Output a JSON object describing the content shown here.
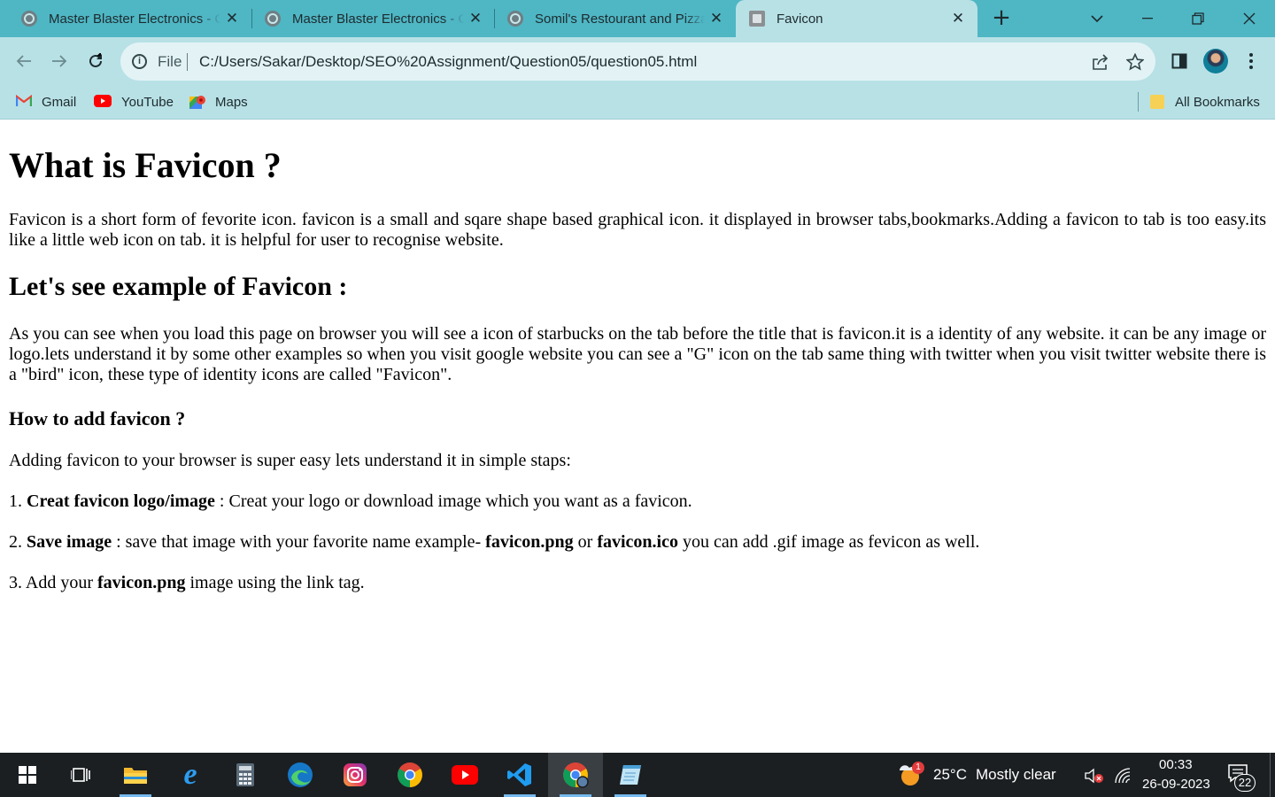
{
  "browser": {
    "tabs": [
      {
        "title": "Master Blaster Electronics - O",
        "active": false
      },
      {
        "title": "Master Blaster Electronics - O",
        "active": false
      },
      {
        "title": "Somil's Restourant and Pizza",
        "active": false
      },
      {
        "title": "Favicon",
        "active": true
      }
    ],
    "address": {
      "scheme_label": "File",
      "url": "C:/Users/Sakar/Desktop/SEO%20Assignment/Question05/question05.html"
    },
    "bookmarks": [
      {
        "label": "Gmail",
        "icon": "gmail-icon"
      },
      {
        "label": "YouTube",
        "icon": "youtube-icon"
      },
      {
        "label": "Maps",
        "icon": "maps-icon"
      }
    ],
    "all_bookmarks_label": "All Bookmarks",
    "theme_color": "#4fb6c4",
    "toolbar_color": "#b8e1e6"
  },
  "page": {
    "title": "What is Favicon ?",
    "intro": "Favicon is a short form of fevorite icon. favicon is a small and sqare shape based graphical icon. it displayed in browser tabs,bookmarks.Adding a favicon to tab is too easy.its like a little web icon on tab. it is helpful for user to recognise website.",
    "example_heading": "Let's see example of Favicon :",
    "example_text": "As you can see when you load this page on browser you will see a icon of starbucks on the tab before the title that is favicon.it is a identity of any website. it can be any image or logo.lets understand it by some other examples so when you visit google website you can see a \"G\" icon on the tab same thing with twitter when you visit twitter website there is a \"bird\" icon, these type of identity icons are called \"Favicon\".",
    "howto_heading": "How to add favicon ?",
    "howto_intro": "Adding favicon to your browser is super easy lets understand it in simple staps:",
    "steps": [
      {
        "num": "1.",
        "bold": "Creat favicon logo/image",
        "text": " : Creat your logo or download image which you want as a favicon."
      },
      {
        "num": "2.",
        "bold": "Save image",
        "text_a": " : save that image with your favorite name example- ",
        "bold_b": "favicon.png",
        "text_b": " or ",
        "bold_c": "favicon.ico",
        "text_c": " you can add .gif image as fevicon as well."
      },
      {
        "num": "3.",
        "text_a": " Add your ",
        "bold": "favicon.png",
        "text_b": " image using the link tag."
      }
    ]
  },
  "taskbar": {
    "weather": {
      "temp": "25°C",
      "condition": "Mostly clear",
      "badge": "1"
    },
    "clock": {
      "time": "00:33",
      "date": "26-09-2023"
    },
    "notifications": "22",
    "apps": [
      "start-icon",
      "task-view-icon",
      "file-explorer-icon",
      "internet-explorer-icon",
      "calculator-icon",
      "edge-icon",
      "instagram-icon",
      "chrome-icon",
      "youtube-icon",
      "vscode-icon",
      "chrome-profile-icon",
      "notepad-icon"
    ]
  }
}
